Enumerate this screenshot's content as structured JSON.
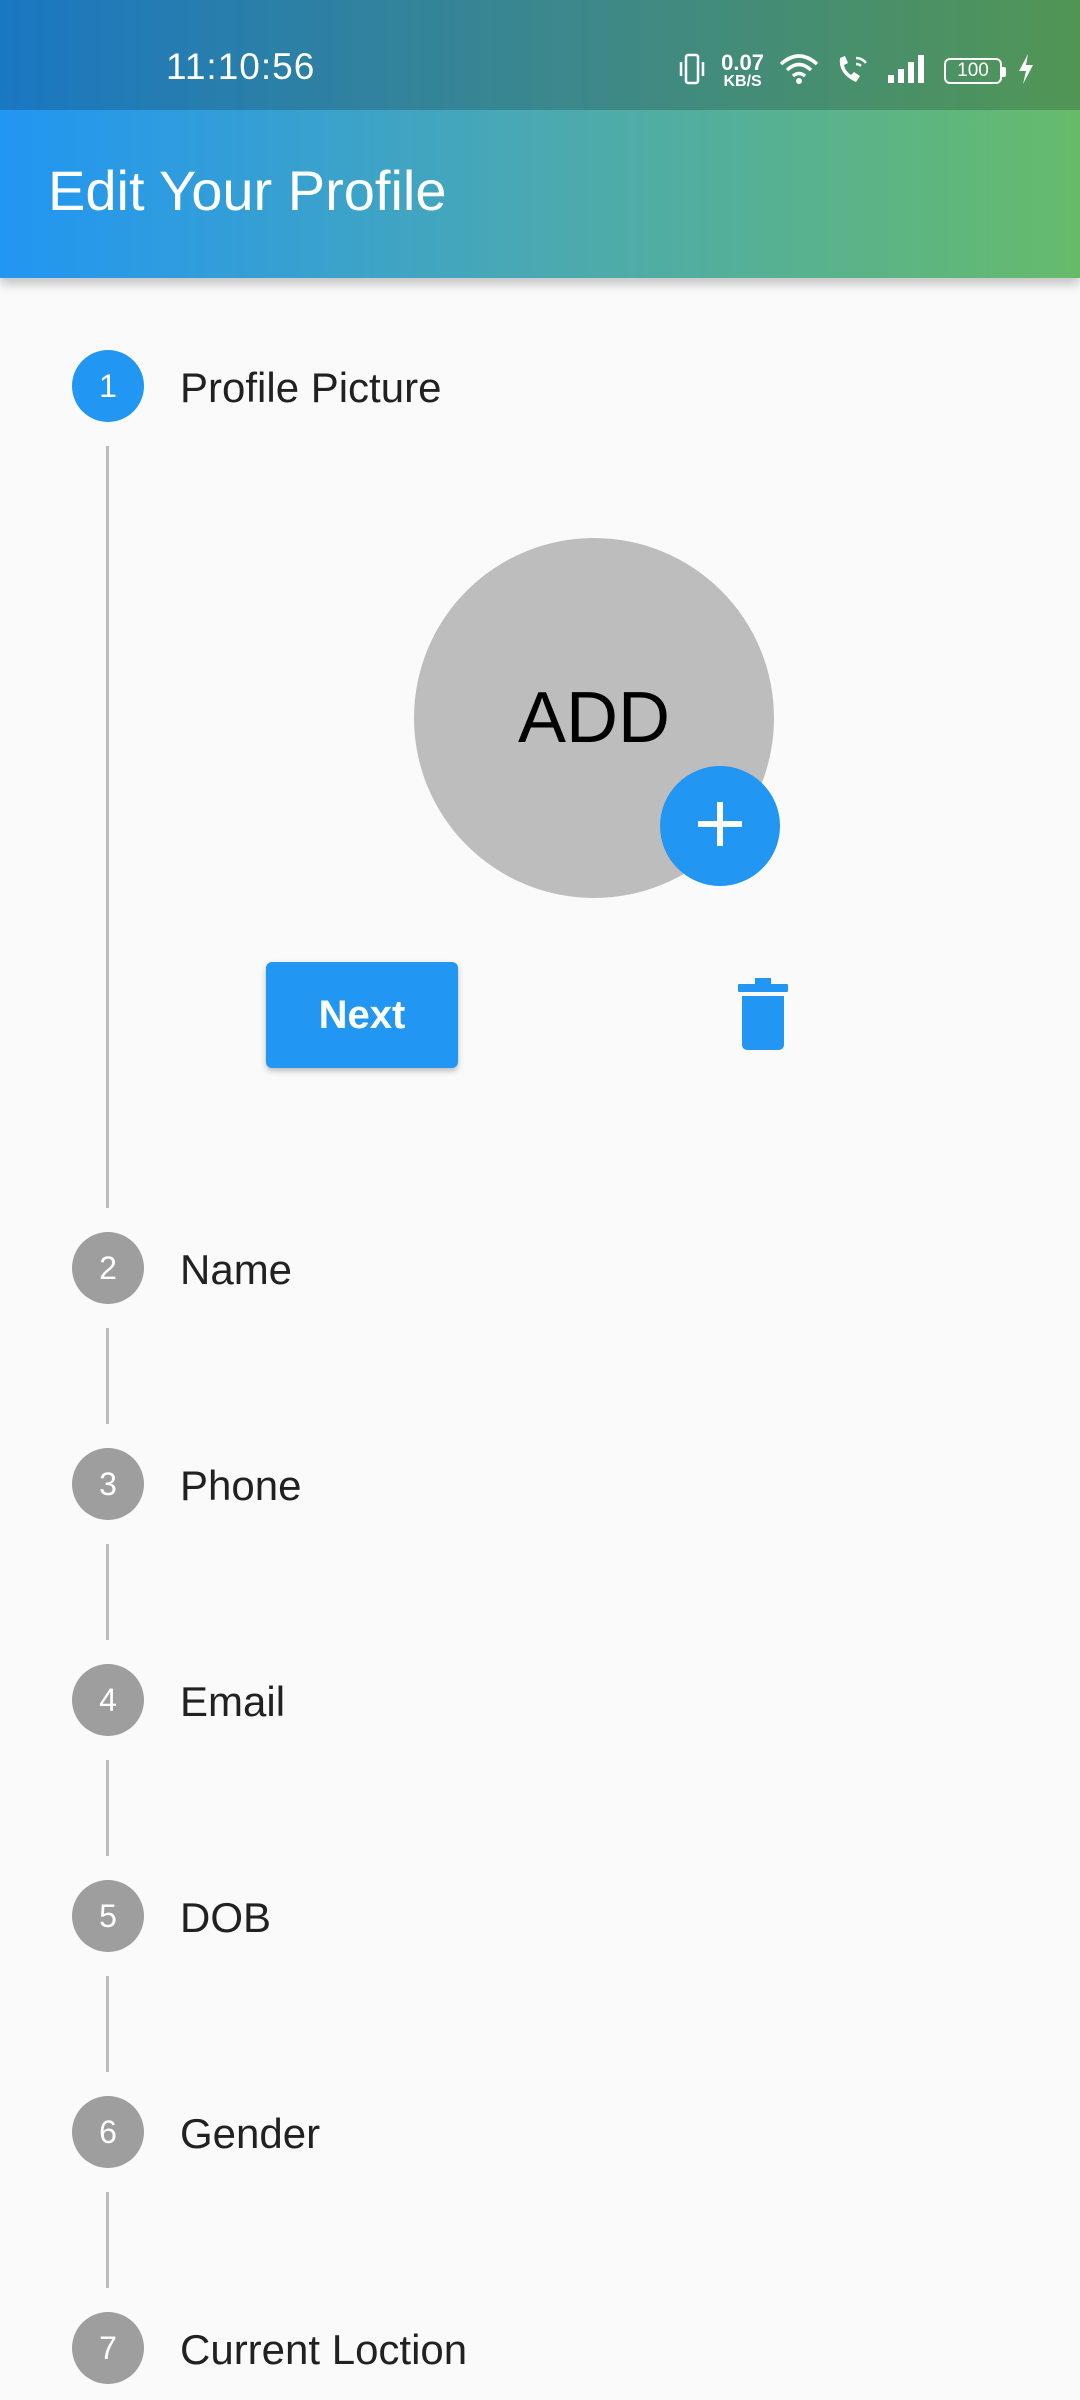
{
  "status_bar": {
    "time": "11:10:56",
    "speed_value": "0.07",
    "speed_unit": "KB/S",
    "battery": "100",
    "icons": [
      "vibrate-icon",
      "wifi-icon",
      "wifi-call-icon",
      "signal-icon",
      "battery-icon",
      "charging-icon"
    ]
  },
  "app_bar": {
    "title": "Edit Your Profile"
  },
  "steps": [
    {
      "number": "1",
      "title": "Profile Picture",
      "state": "active"
    },
    {
      "number": "2",
      "title": "Name",
      "state": "inactive"
    },
    {
      "number": "3",
      "title": "Phone",
      "state": "inactive"
    },
    {
      "number": "4",
      "title": "Email",
      "state": "inactive"
    },
    {
      "number": "5",
      "title": "DOB",
      "state": "inactive"
    },
    {
      "number": "6",
      "title": "Gender",
      "state": "inactive"
    },
    {
      "number": "7",
      "title": "Current Loction",
      "state": "inactive"
    }
  ],
  "profile_picture": {
    "placeholder_label": "ADD",
    "add_icon": "plus-icon",
    "delete_icon": "trash-icon"
  },
  "actions": {
    "next_label": "Next"
  },
  "colors": {
    "primary": "#2196F3",
    "accent_green": "#66BB6A",
    "inactive_step": "#9E9E9E",
    "avatar_bg": "#BDBDBD"
  }
}
